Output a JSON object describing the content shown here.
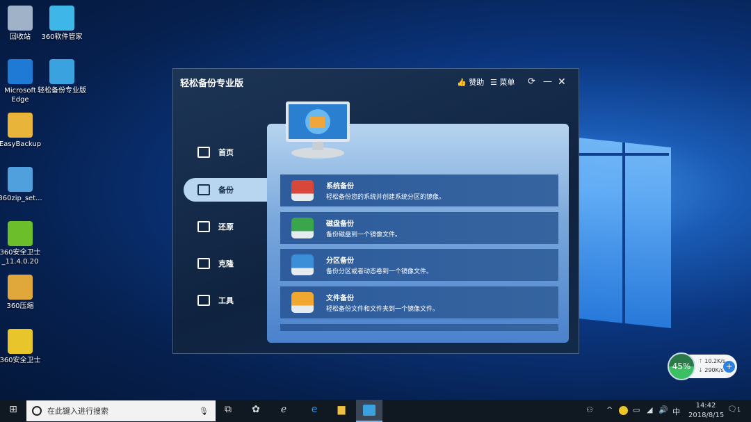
{
  "desktop_icons": [
    {
      "label": "回收站",
      "color": "#9fb2c8"
    },
    {
      "label": "360软件管家",
      "color": "#3fb6e8"
    },
    {
      "label": "Microsoft Edge",
      "color": "#1f7ad6"
    },
    {
      "label": "轻松备份专业版",
      "color": "#3ba2e0"
    },
    {
      "label": "EasyBackup",
      "color": "#e8b43a"
    },
    {
      "label": "360zip_set...",
      "color": "#4fa0dd"
    },
    {
      "label": "360安全卫士_11.4.0.20",
      "color": "#6cbf2a"
    },
    {
      "label": "360压缩",
      "color": "#e0a73a"
    },
    {
      "label": "360安全卫士",
      "color": "#e8c52a"
    }
  ],
  "window": {
    "title": "轻松备份专业版",
    "sponsor": "赞助",
    "menu": "菜单",
    "sidebar": [
      "首页",
      "备份",
      "还原",
      "克隆",
      "工具"
    ],
    "items": [
      {
        "title": "系统备份",
        "desc": "轻松备份您的系统并创建系统分区的镜像。",
        "color": "#d8473a"
      },
      {
        "title": "磁盘备份",
        "desc": "备份磁盘到一个镜像文件。",
        "color": "#3aa54a"
      },
      {
        "title": "分区备份",
        "desc": "备份分区或者动态卷到一个镜像文件。",
        "color": "#3a8fd8"
      },
      {
        "title": "文件备份",
        "desc": "轻松备份文件和文件夹到一个镜像文件。",
        "color": "#f0a830"
      }
    ]
  },
  "widget": {
    "percent": "45%",
    "up": "10.2K/s",
    "down": "290K/s"
  },
  "taskbar": {
    "search_placeholder": "在此键入进行搜索",
    "time": "14:42",
    "date": "2018/8/15",
    "ime": "中",
    "notifications": "1"
  }
}
